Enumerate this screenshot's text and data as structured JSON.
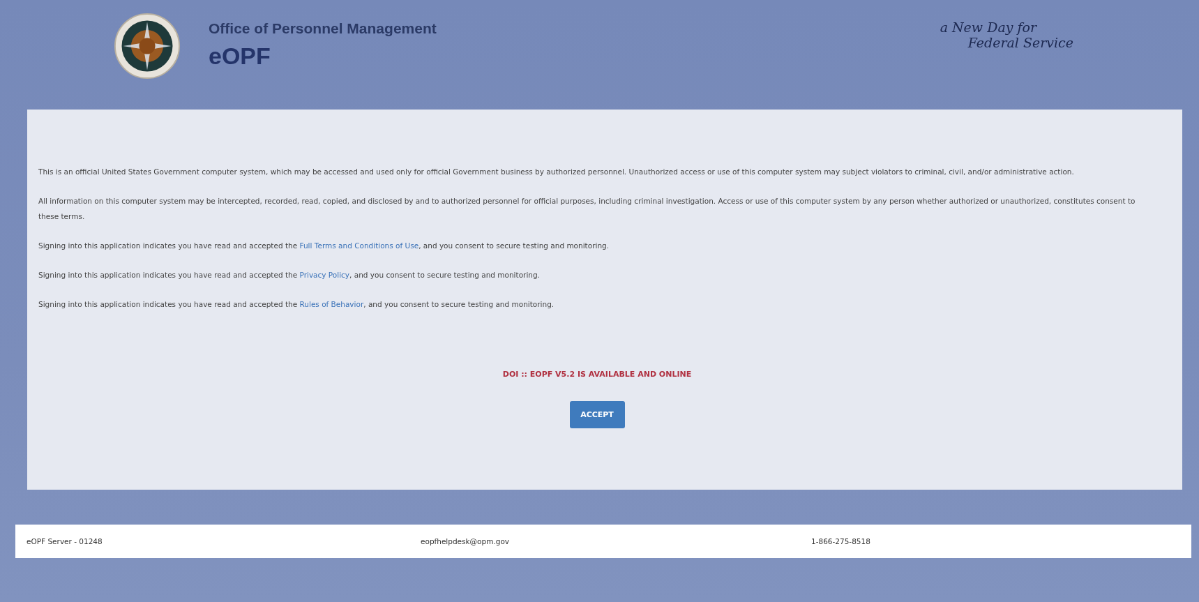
{
  "header": {
    "organization": "Office of Personnel Management",
    "app_name": "eOPF",
    "tagline": [
      "a New Day for",
      "Federal Service"
    ]
  },
  "notice": {
    "paragraphs": [
      {
        "text": "This is an official United States Government computer system, which may be accessed and used only for official Government business by authorized personnel. Unauthorized access or use of this computer system may subject violators to criminal, civil, and/or administrative action."
      },
      {
        "text": "All information on this computer system may be intercepted, recorded, read, copied, and disclosed by and to authorized personnel for official purposes, including criminal investigation. Access or use of this computer system by any person whether authorized or unauthorized, constitutes consent to these terms."
      },
      {
        "text": "Signing into this application indicates you have read and accepted the ",
        "link": "Full Terms and Conditions of Use",
        "after": ", and you consent to secure testing and monitoring."
      },
      {
        "text": "Signing into this application indicates you have read and accepted the ",
        "link": "Privacy Policy",
        "after": ", and you consent to secure testing and monitoring."
      },
      {
        "text": "Signing into this application indicates you have read and accepted the ",
        "link": "Rules of Behavior",
        "after": ", and you consent to secure testing and monitoring."
      }
    ],
    "status_message": "DOI :: EOPF V5.2 IS AVAILABLE AND ONLINE",
    "accept_button": "ACCEPT"
  },
  "footer": {
    "server": "eOPF Server - 01248",
    "email": "eopfhelpdesk@opm.gov",
    "phone": "1-866-275-8518"
  }
}
